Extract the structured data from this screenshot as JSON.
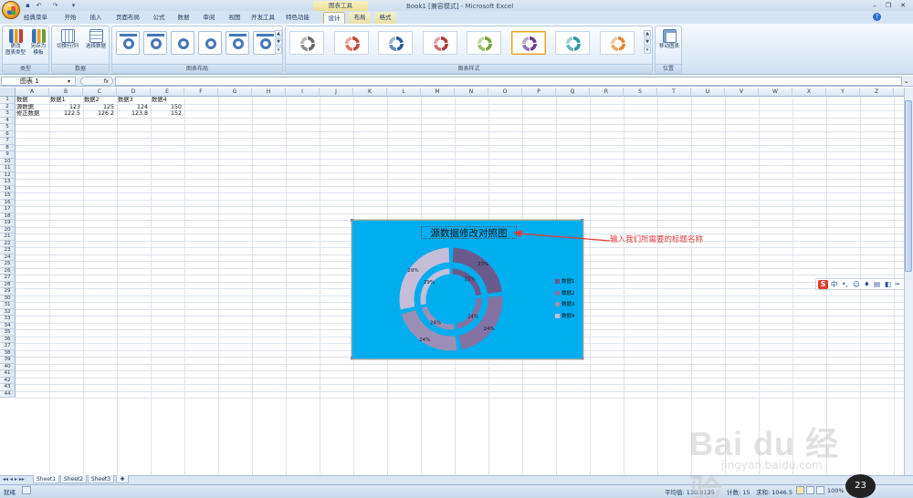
{
  "titlebar": {
    "title": "Book1  [兼容模式] - Microsoft Excel",
    "tools_title": "图表工具",
    "quick_access": [
      "save-icon",
      "undo-icon",
      "redo-icon",
      "customize-icon"
    ]
  },
  "tabs": [
    {
      "label": "经典菜单",
      "active": false
    },
    {
      "label": "开始",
      "active": false
    },
    {
      "label": "插入",
      "active": false
    },
    {
      "label": "页面布局",
      "active": false
    },
    {
      "label": "公式",
      "active": false
    },
    {
      "label": "数据",
      "active": false
    },
    {
      "label": "审阅",
      "active": false
    },
    {
      "label": "视图",
      "active": false
    },
    {
      "label": "开发工具",
      "active": false
    },
    {
      "label": "特色功能",
      "active": false
    },
    {
      "label": "设计",
      "active": true,
      "tool": true
    },
    {
      "label": "布局",
      "active": false,
      "tool": true
    },
    {
      "label": "格式",
      "active": false,
      "tool": true
    }
  ],
  "ribbon": {
    "groups": [
      {
        "label": "类型",
        "buttons": [
          {
            "label1": "更改",
            "label2": "图表类型"
          },
          {
            "label1": "另存为",
            "label2": "模板"
          }
        ]
      },
      {
        "label": "数据",
        "buttons": [
          {
            "label1": "切换行/列",
            "label2": ""
          },
          {
            "label1": "选择数据",
            "label2": ""
          }
        ]
      },
      {
        "label": "图表布局"
      },
      {
        "label": "图表样式"
      },
      {
        "label": "位置",
        "buttons": [
          {
            "label1": "移动图表",
            "label2": ""
          }
        ]
      }
    ],
    "style_colors": [
      "#6b6b6b",
      "#c8473f",
      "#2f5e9e",
      "#b53a3a",
      "#7aa43b",
      "#6a3e8f",
      "#2a9aa8",
      "#e08a2e"
    ],
    "selected_style": 5
  },
  "formula_bar": {
    "name_box": "图表 1",
    "fx_label": "fx",
    "value": ""
  },
  "sheet": {
    "columns": [
      "A",
      "B",
      "C",
      "D",
      "E",
      "F",
      "G",
      "H",
      "I",
      "J",
      "K",
      "L",
      "M",
      "N",
      "O",
      "P",
      "Q",
      "R",
      "S",
      "T",
      "U",
      "V",
      "W",
      "X",
      "Y",
      "Z"
    ],
    "row_count": 44,
    "cells": [
      [
        "数据",
        "数据1",
        "数据2",
        "数据3",
        "数据4"
      ],
      [
        "源数据",
        "123",
        "125",
        "124",
        "150"
      ],
      [
        "修正数据",
        "122.5",
        "126.2",
        "123.8",
        "152"
      ]
    ]
  },
  "chart_data": {
    "type": "donut",
    "title": "源数据修改对照图",
    "categories": [
      "数据1",
      "数据2",
      "数据3",
      "数据4"
    ],
    "series": [
      {
        "name": "源数据",
        "values": [
          123,
          125,
          124,
          150
        ]
      },
      {
        "name": "修正数据",
        "values": [
          122.5,
          126.2,
          123.8,
          152
        ]
      }
    ],
    "data_labels": {
      "inner": [
        "23%",
        "24%",
        "24%",
        "29%"
      ],
      "outer": [
        "23%",
        "24%",
        "24%",
        "29%"
      ]
    },
    "legend_position": "right",
    "colors": [
      "#6a5a8c",
      "#8472a2",
      "#9c8fb6",
      "#c6bed8"
    ],
    "background": "#00adee"
  },
  "annotation": {
    "text": "输入我们所需要的标题名称",
    "color": "#e83a3a"
  },
  "ime": {
    "label": "中",
    "icons": [
      "pinyin-s-icon",
      "punct-icon",
      "emoji-icon",
      "mic-icon",
      "keyboard-icon",
      "skin-icon",
      "tools-icon"
    ]
  },
  "sheet_tabs": [
    "Sheet1",
    "Sheet2",
    "Sheet3"
  ],
  "status_bar": {
    "mode": "就绪",
    "average": "平均值: 130.8125",
    "count": "计数: 15",
    "sum": "求和: 1046.5",
    "zoom": "100%",
    "zoom_bubble": "23"
  },
  "watermark": {
    "text": "Bai du 经验",
    "sub": "jingyan.baidu.com"
  }
}
